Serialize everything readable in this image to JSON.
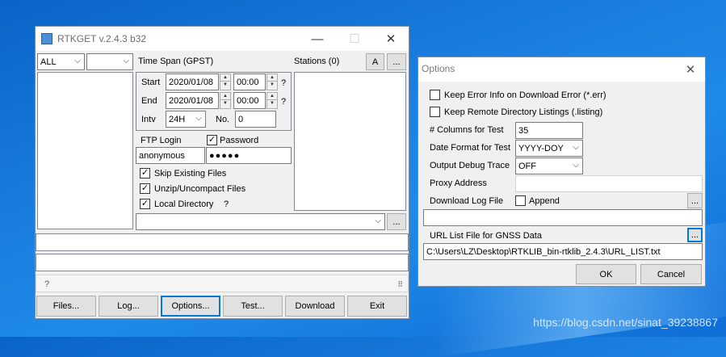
{
  "rtkget": {
    "title": "RTKGET v.2.4.3 b32",
    "filter_combo": "ALL",
    "filter_combo2": "",
    "time_span_label": "Time Span (GPST)",
    "start_label": "Start",
    "start_date": "2020/01/08",
    "start_time": "00:00",
    "end_label": "End",
    "end_date": "2020/01/08",
    "end_time": "00:00",
    "help_mark": "?",
    "intv_label": "Intv",
    "intv_value": "24H",
    "no_label": "No.",
    "no_value": "0",
    "ftp_login_label": "FTP Login",
    "ftp_login_value": "anonymous",
    "password_label": "Password",
    "password_value": "●●●●●",
    "skip_existing": "Skip Existing Files",
    "unzip": "Unzip/Uncompact Files",
    "local_dir": "Local Directory",
    "local_dir_help": "?",
    "stations_label": "Stations (0)",
    "a_button": "A",
    "browse": "...",
    "status_q": "?",
    "buttons": {
      "files": "Files...",
      "log": "Log...",
      "options": "Options...",
      "test": "Test...",
      "download": "Download",
      "exit": "Exit"
    }
  },
  "options": {
    "title": "Options",
    "keep_error": "Keep Error Info on Download Error (*.err)",
    "keep_remote": "Keep Remote Directory Listings (.listing)",
    "columns_label": "# Columns for Test",
    "columns_value": "35",
    "date_format_label": "Date Format for Test",
    "date_format_value": "YYYY-DOY",
    "debug_label": "Output Debug Trace",
    "debug_value": "OFF",
    "proxy_label": "Proxy Address",
    "proxy_value": "",
    "log_label": "Download Log File",
    "append_label": "Append",
    "log_value": "",
    "url_label": "URL List File for GNSS Data",
    "url_value": "C:\\Users\\LZ\\Desktop\\RTKLIB_bin-rtklib_2.4.3\\URL_LIST.txt",
    "browse": "...",
    "ok": "OK",
    "cancel": "Cancel"
  },
  "watermark": "https://blog.csdn.net/sinat_39238867"
}
